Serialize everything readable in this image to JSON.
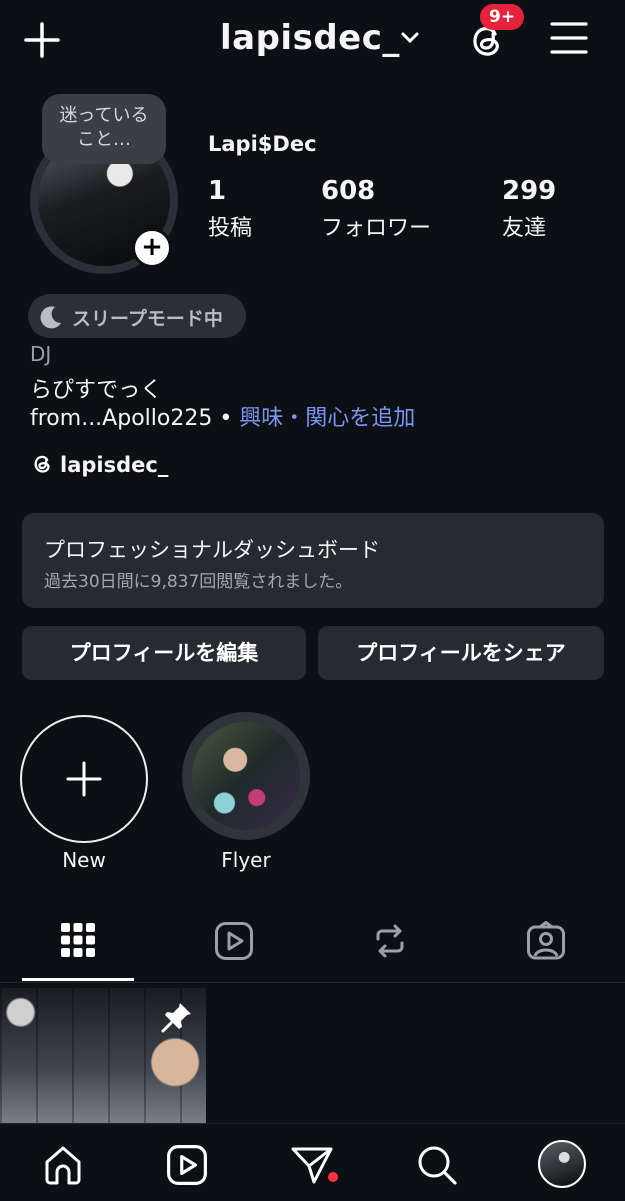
{
  "header": {
    "username": "lapisdec_",
    "notification_badge": "9+"
  },
  "profile": {
    "note": "迷っている\nこと…",
    "display_name": "Lapi$Dec",
    "stats": [
      {
        "value": "1",
        "label": "投稿"
      },
      {
        "value": "608",
        "label": "フォロワー"
      },
      {
        "value": "299",
        "label": "友達"
      }
    ],
    "status_pill": "スリープモード中",
    "bio_category": "DJ",
    "bio_line1": "らぴすでっく",
    "bio_line2": "from...Apollo225",
    "bio_separator": " • ",
    "bio_link": "興味・関心を追加",
    "threads_handle": "lapisdec_"
  },
  "dashboard": {
    "title": "プロフェッショナルダッシュボード",
    "subtitle": "過去30日間に9,837回閲覧されました。"
  },
  "buttons": {
    "edit": "プロフィールを編集",
    "share": "プロフィールをシェア"
  },
  "highlights": [
    {
      "label": "New"
    },
    {
      "label": "Flyer"
    }
  ],
  "colors": {
    "background": "#0c0f14",
    "card": "#262a31",
    "link": "#7c95f2",
    "badge": "#e8213b"
  }
}
